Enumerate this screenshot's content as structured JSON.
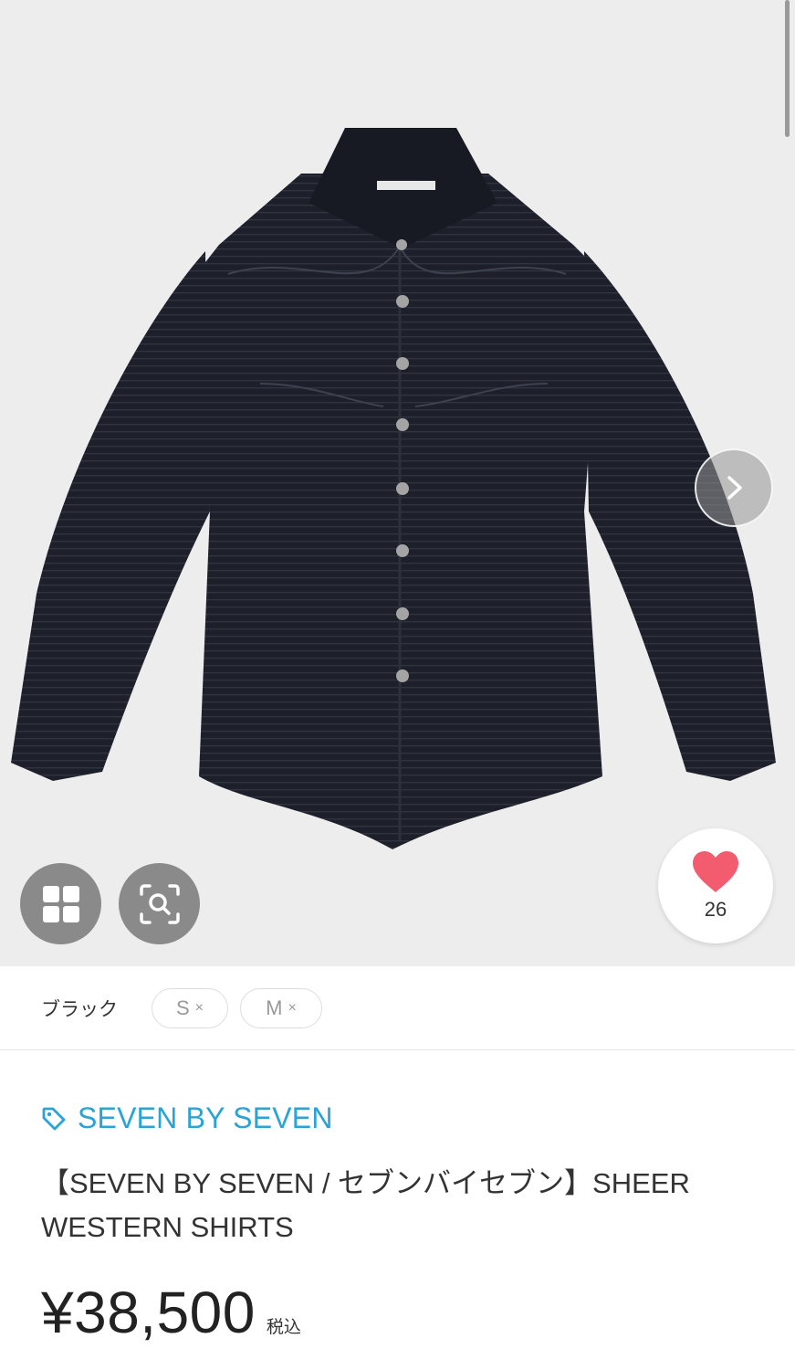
{
  "gallery": {
    "image_subject": "black sheer western shirt",
    "next_icon": "chevron-right-icon",
    "grid_icon": "grid-view-icon",
    "zoom_icon": "image-search-icon",
    "like_icon": "heart-icon",
    "like_count": "26",
    "heart_color": "#f25c6e"
  },
  "variant": {
    "color_label": "ブラック",
    "sizes": [
      {
        "label": "S",
        "mark": "×"
      },
      {
        "label": "M",
        "mark": "×"
      }
    ]
  },
  "product": {
    "brand_icon": "tag-icon",
    "brand": "SEVEN BY SEVEN",
    "brand_color": "#2aa3d6",
    "title": "【SEVEN BY SEVEN / セブンバイセブン】SHEER WESTERN SHIRTS",
    "price": "¥38,500",
    "tax_label": "税込"
  }
}
